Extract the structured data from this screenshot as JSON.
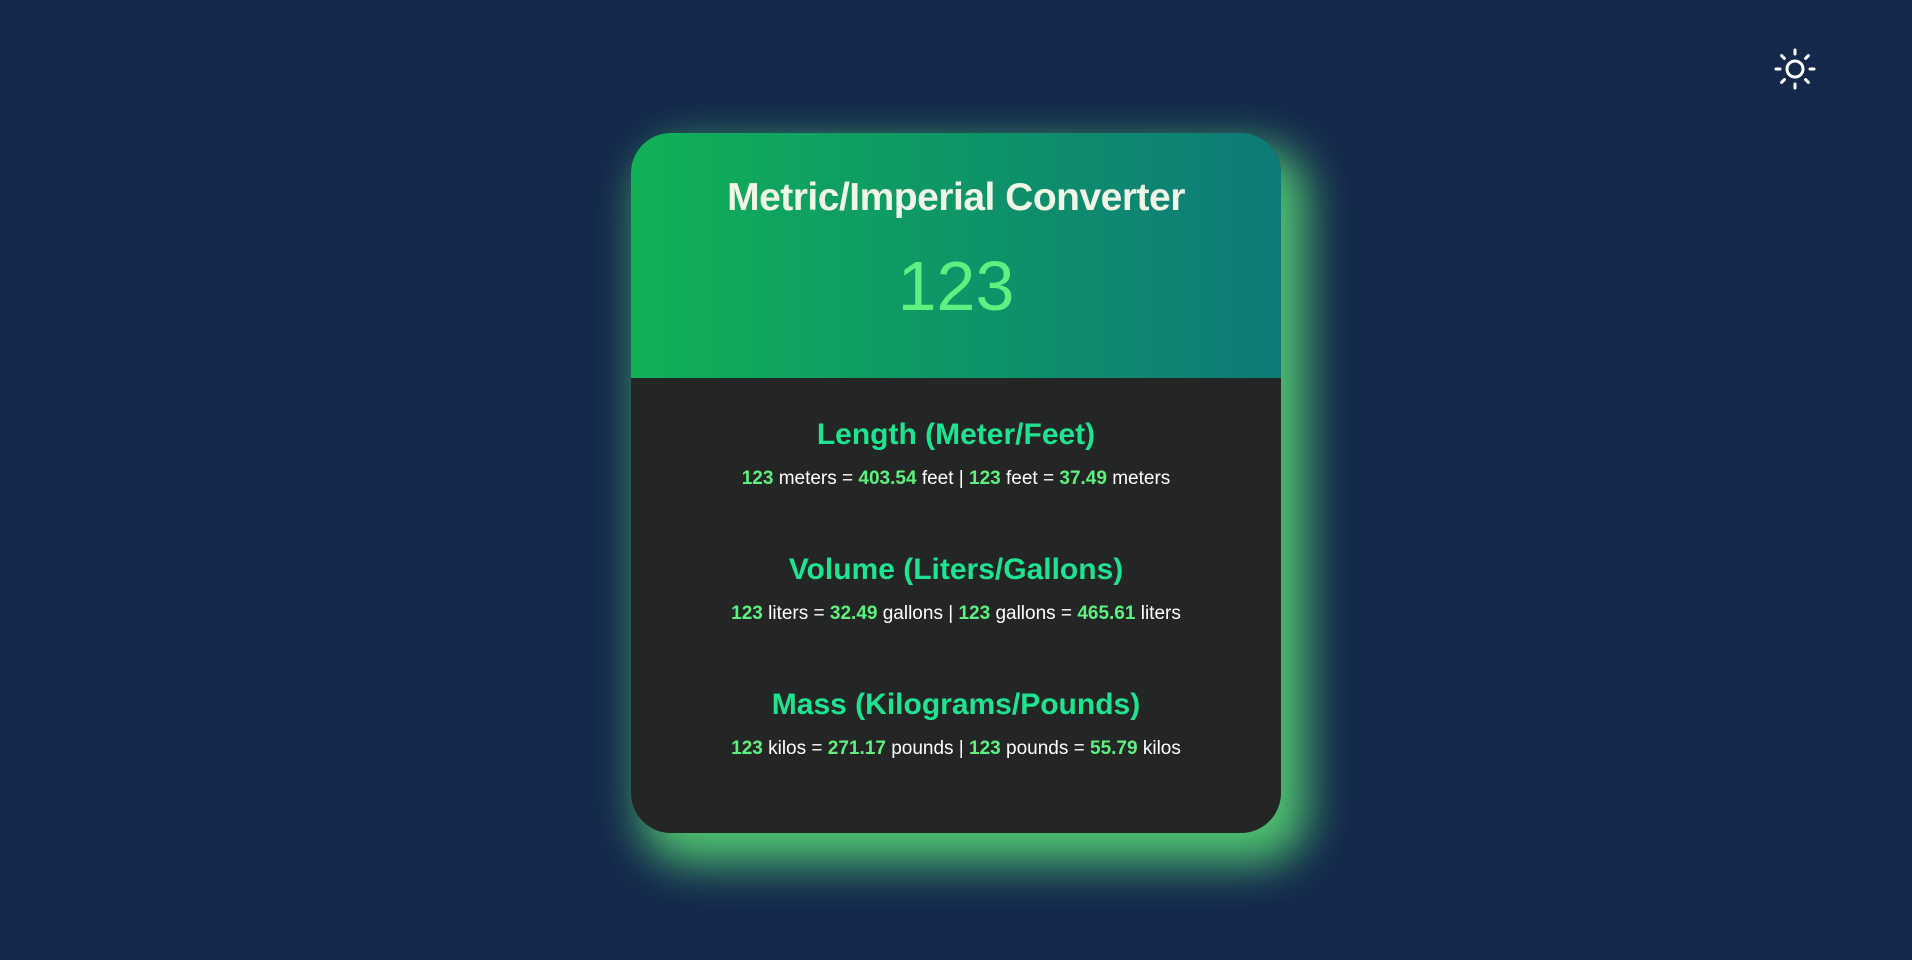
{
  "theme_toggle": {
    "icon": "sun-icon"
  },
  "converter": {
    "title": "Metric/Imperial Converter",
    "input_value": "123"
  },
  "sections": [
    {
      "title": "Length (Meter/Feet)",
      "a_value": "123",
      "a_unit": "meters",
      "a_result": "403.54",
      "a_result_unit": "feet",
      "b_value": "123",
      "b_unit": "feet",
      "b_result": "37.49",
      "b_result_unit": "meters"
    },
    {
      "title": "Volume (Liters/Gallons)",
      "a_value": "123",
      "a_unit": "liters",
      "a_result": "32.49",
      "a_result_unit": "gallons",
      "b_value": "123",
      "b_unit": "gallons",
      "b_result": "465.61",
      "b_result_unit": "liters"
    },
    {
      "title": "Mass (Kilograms/Pounds)",
      "a_value": "123",
      "a_unit": "kilos",
      "a_result": "271.17",
      "a_result_unit": "pounds",
      "b_value": "123",
      "b_unit": "pounds",
      "b_result": "55.79",
      "b_result_unit": "kilos"
    }
  ],
  "colors": {
    "background": "#14284b",
    "header_gradient_start": "#10b157",
    "header_gradient_end": "#0d7a78",
    "card_body": "#232624",
    "accent_number": "#5ef180",
    "section_title": "#1ee391",
    "glow": "#5ae178"
  }
}
